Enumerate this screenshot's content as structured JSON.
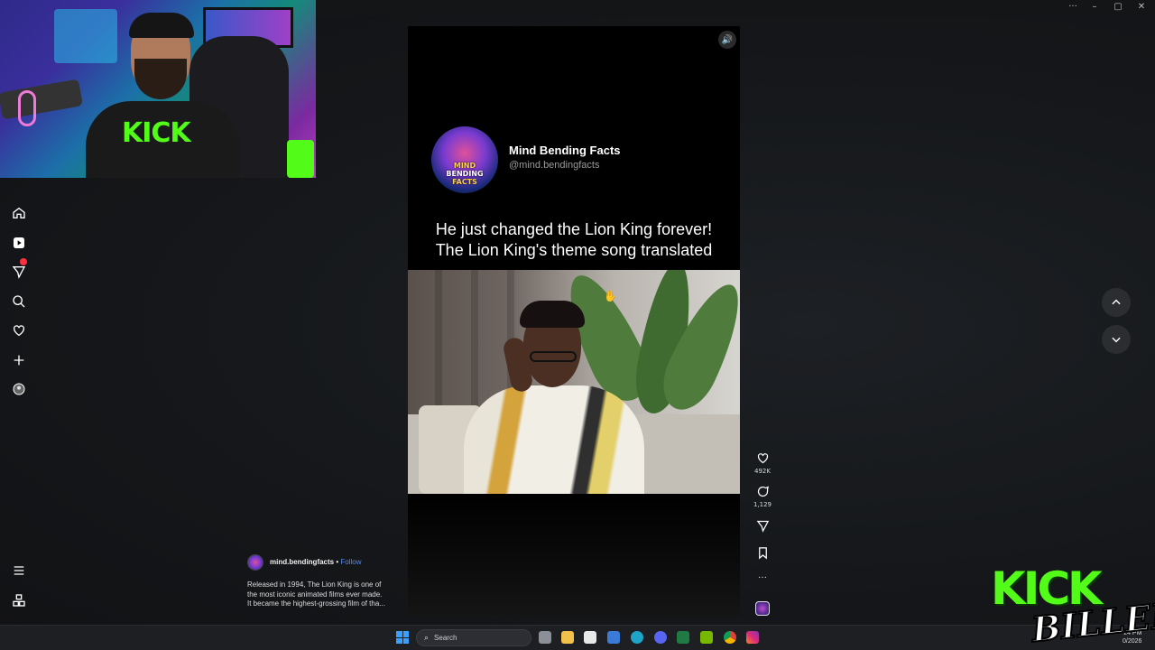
{
  "window": {
    "more_label": "···",
    "minimize_label": "–",
    "maximize_label": "▢",
    "close_label": "✕"
  },
  "sidebar": {
    "items": [
      {
        "name": "home",
        "icon": "home-icon"
      },
      {
        "name": "reels",
        "icon": "reels-icon"
      },
      {
        "name": "messages",
        "icon": "messages-icon",
        "has_notification": true
      },
      {
        "name": "search",
        "icon": "search-icon"
      },
      {
        "name": "notifications",
        "icon": "heart-icon"
      },
      {
        "name": "create",
        "icon": "plus-icon"
      },
      {
        "name": "profile",
        "icon": "profile-avatar"
      }
    ],
    "bottom": [
      {
        "name": "more",
        "icon": "hamburger-menu-icon"
      },
      {
        "name": "also-from-meta",
        "icon": "apps-grid-icon"
      }
    ]
  },
  "reel": {
    "mute_icon": "🔊",
    "account_name": "Mind Bending Facts",
    "account_handle": "@mind.bendingfacts",
    "logo_lines": [
      "MIND",
      "BENDING",
      "FACTS"
    ],
    "headline_line1": "He just changed the Lion King forever!",
    "headline_line2": "The Lion King's theme song translated"
  },
  "actions": {
    "likes": "492K",
    "comments": "1,129",
    "more_label": "···"
  },
  "caption": {
    "username": "mind.bendingfacts",
    "separator": " • ",
    "follow": "Follow",
    "text_line1": "Released in 1994, The Lion King is one of",
    "text_line2": "the most iconic animated films ever made.",
    "text_line3": "It became the highest-grossing film of tha..."
  },
  "overlay": {
    "kick": "KICK",
    "billeh": "BILLEH"
  },
  "taskbar": {
    "search_placeholder": "Search",
    "clock_time": "24 PM",
    "clock_date": "0/2026"
  },
  "colors": {
    "kick_green": "#53fc18",
    "follow_blue": "#4f8cff",
    "notification_red": "#ff3040"
  }
}
